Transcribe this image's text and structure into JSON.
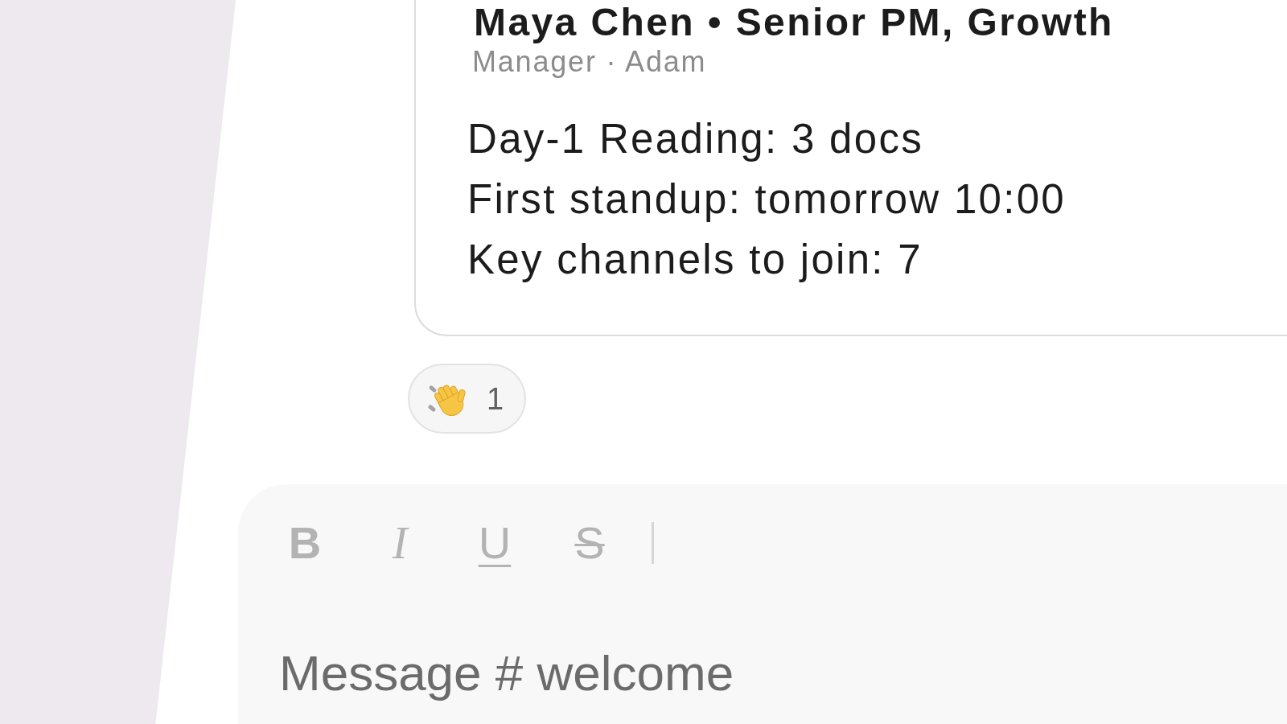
{
  "message_card": {
    "title": "Maya Chen • Senior PM, Growth",
    "subtitle": "Manager · Adam",
    "facts": [
      "Day-1 Reading: 3 docs",
      "First standup: tomorrow 10:00",
      "Key channels to join: 7"
    ]
  },
  "reactions": [
    {
      "count": "1"
    }
  ],
  "composer": {
    "toolbar": [
      {
        "kind": "bold",
        "label": "B"
      },
      {
        "kind": "italic",
        "label": "I"
      },
      {
        "kind": "underline",
        "label": "U"
      },
      {
        "kind": "strikethrough",
        "label": "S"
      }
    ],
    "placeholder": "Message # welcome"
  }
}
